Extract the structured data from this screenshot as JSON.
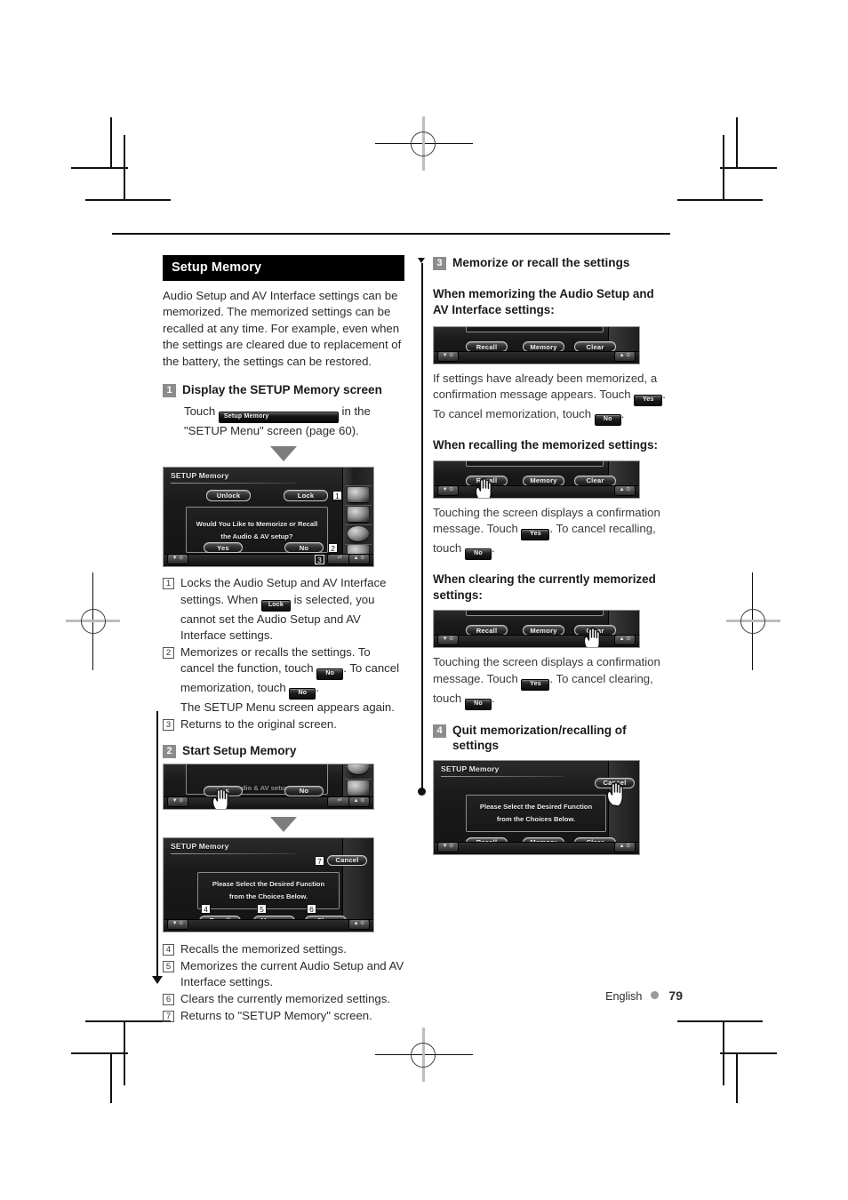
{
  "page": {
    "footer_language": "English",
    "footer_page_number": "79",
    "accent_gray": "#8c8c8c",
    "header_bg": "#000000"
  },
  "left_column": {
    "section_title": "Setup Memory",
    "intro": "Audio Setup and AV Interface settings can be memorized. The memorized settings can be recalled at any time. For example, even when the settings are cleared due to replacement of the battery, the settings can be restored.",
    "step1": {
      "number": "1",
      "title": "Display the SETUP Memory screen",
      "instruction_before": "Touch",
      "chip_label": "Setup Memory",
      "instruction_after": "in the \"SETUP Menu\" screen (page 60)."
    },
    "screen1": {
      "title": "SETUP Memory",
      "unlock": "Unlock",
      "lock": "Lock",
      "message_line1": "Would You Like to Memorize or Recall",
      "message_line2": "the Audio & AV setup?",
      "yes": "Yes",
      "no": "No",
      "callout_lock": "1",
      "callout_no": "2",
      "callout_back": "3"
    },
    "reflist1": [
      {
        "num": "1",
        "text_a": "Locks the Audio Setup and AV Interface settings. When",
        "chip": "Lock",
        "text_b": "is selected, you cannot set the Audio Setup and AV Interface settings."
      },
      {
        "num": "2",
        "text_a": "Memorizes or recalls the settings. To cancel the function, touch",
        "chip": "No",
        "text_b": ". To cancel memorization, touch",
        "chip2": "No",
        "text_c": ".",
        "extra": "The SETUP Menu screen appears again."
      },
      {
        "num": "3",
        "text_a": "Returns to the original screen."
      }
    ],
    "step2": {
      "number": "2",
      "title": "Start Setup Memory"
    },
    "screen2": {
      "partial_message": "the Audio & AV setup?",
      "yes": "Yes",
      "no": "No"
    },
    "screen3": {
      "title": "SETUP Memory",
      "cancel": "Cancel",
      "message_line1": "Please Select the Desired Function",
      "message_line2": "from the Choices Below.",
      "recall": "Recall",
      "memory": "Memory",
      "clear": "Clear",
      "callout_cancel": "7",
      "callout_recall": "4",
      "callout_memory": "5",
      "callout_clear": "6"
    },
    "reflist2": [
      {
        "num": "4",
        "text_a": "Recalls the memorized settings."
      },
      {
        "num": "5",
        "text_a": "Memorizes the current Audio Setup and AV Interface settings."
      },
      {
        "num": "6",
        "text_a": "Clears the currently memorized settings."
      },
      {
        "num": "7",
        "text_a": "Returns to \"SETUP Memory\" screen."
      }
    ]
  },
  "right_column": {
    "step3": {
      "number": "3",
      "title": "Memorize or recall the settings"
    },
    "memorizing": {
      "subhead": "When memorizing the Audio Setup and AV Interface settings:",
      "screen": {
        "recall": "Recall",
        "memory": "Memory",
        "clear": "Clear"
      },
      "text_a": "If settings have already been memorized, a confirmation message appears. Touch",
      "chip_yes": "Yes",
      "text_b": ". To cancel memorization, touch",
      "chip_no": "No",
      "text_c": "."
    },
    "recalling": {
      "subhead": "When recalling the memorized settings:",
      "screen": {
        "recall": "Recall",
        "memory": "Memory",
        "clear": "Clear"
      },
      "text_a": "Touching the screen displays a confirmation message. Touch",
      "chip_yes": "Yes",
      "text_b": ". To cancel recalling, touch",
      "chip_no": "No",
      "text_c": "."
    },
    "clearing": {
      "subhead": "When clearing the currently memorized settings:",
      "screen": {
        "recall": "Recall",
        "memory": "Memory",
        "clear": "Clear"
      },
      "text_a": "Touching the screen displays a confirmation message. Touch",
      "chip_yes": "Yes",
      "text_b": ". To cancel clearing, touch",
      "chip_no": "No",
      "text_c": "."
    },
    "step4": {
      "number": "4",
      "title": "Quit memorization/recalling of settings",
      "screen": {
        "title": "SETUP Memory",
        "cancel": "Cancel",
        "message_line1": "Please Select the Desired Function",
        "message_line2": "from the Choices Below.",
        "recall": "Recall",
        "memory": "Memory",
        "clear": "Clear"
      }
    }
  }
}
